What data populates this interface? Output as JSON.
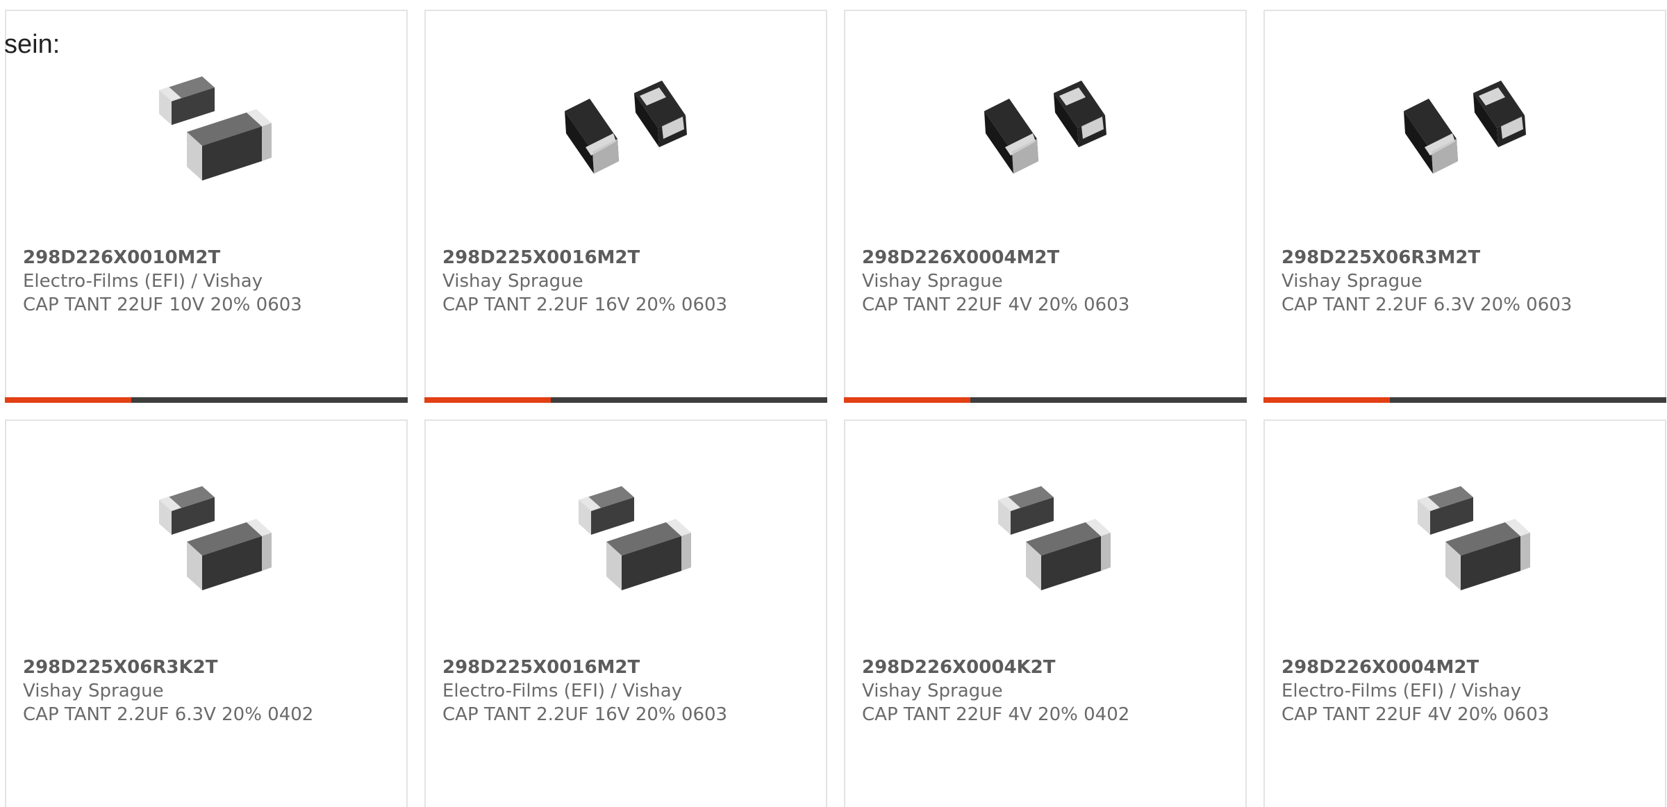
{
  "intro_text": "sein:",
  "colors": {
    "accent": "#e23f14",
    "bar_dark": "#3e3e3e",
    "card_border": "#e3e3e3",
    "text_gray": "#6a6a6a"
  },
  "products": [
    {
      "part": "298D226X0010M2T",
      "manufacturer": "Electro-Films (EFI) / Vishay",
      "description": "CAP TANT 22UF 10V 20% 0603",
      "image_icon": "capacitor-pair-light-icon",
      "show_bar": true
    },
    {
      "part": "298D225X0016M2T",
      "manufacturer": "Vishay Sprague",
      "description": "CAP TANT 2.2UF 16V 20% 0603",
      "image_icon": "capacitor-pair-dark-icon",
      "show_bar": true
    },
    {
      "part": "298D226X0004M2T",
      "manufacturer": "Vishay Sprague",
      "description": "CAP TANT 22UF 4V 20% 0603",
      "image_icon": "capacitor-pair-dark-icon",
      "show_bar": true
    },
    {
      "part": "298D225X06R3M2T",
      "manufacturer": "Vishay Sprague",
      "description": "CAP TANT 2.2UF 6.3V 20% 0603",
      "image_icon": "capacitor-pair-dark-icon",
      "show_bar": true
    },
    {
      "part": "298D225X06R3K2T",
      "manufacturer": "Vishay Sprague",
      "description": "CAP TANT 2.2UF 6.3V 20% 0402",
      "image_icon": "capacitor-pair-light-icon",
      "show_bar": false
    },
    {
      "part": "298D225X0016M2T",
      "manufacturer": "Electro-Films (EFI) / Vishay",
      "description": "CAP TANT 2.2UF 16V 20% 0603",
      "image_icon": "capacitor-pair-light-icon",
      "show_bar": false
    },
    {
      "part": "298D226X0004K2T",
      "manufacturer": "Vishay Sprague",
      "description": "CAP TANT 22UF 4V 20% 0402",
      "image_icon": "capacitor-pair-light-icon",
      "show_bar": false
    },
    {
      "part": "298D226X0004M2T",
      "manufacturer": "Electro-Films (EFI) / Vishay",
      "description": "CAP TANT 22UF 4V 20% 0603",
      "image_icon": "capacitor-pair-light-icon",
      "show_bar": false
    }
  ]
}
